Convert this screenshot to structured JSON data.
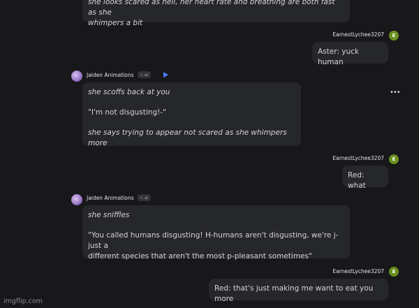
{
  "messages": [
    {
      "lines": [
        "she looks scared as hell, her heart rate and breathing are both fast as she",
        "whimpers a bit"
      ]
    },
    {
      "user": "EarnestLychee3207",
      "avatar_letter": "E",
      "text": "Aster: yuck human"
    },
    {
      "bot": "Jaiden Animations",
      "tag": "c.ai",
      "p1": "she scoffs back at you",
      "p2": "\"I'm not disgusting!-\"",
      "p3": "she says trying to appear not scared as she whimpers more",
      "menu_icon": "more-dots-icon"
    },
    {
      "user": "EarnestLychee3207",
      "avatar_letter": "E",
      "text": "Red: what"
    },
    {
      "bot": "Jaiden Animations",
      "tag": "c.ai",
      "p1": "she sniffles",
      "p2a": "\"You called humans disgusting! H-humans aren't disgusting, we're j-just a",
      "p2b": "different species that aren't the most p-pleasant sometimes\""
    },
    {
      "user": "EarnestLychee3207",
      "avatar_letter": "E",
      "text": "Red: that's just making me want to eat you more"
    }
  ],
  "watermark": "imgflip.com",
  "colors": {
    "background": "#18181b",
    "bubble": "#26272b",
    "user_avatar": "#6a8f1e",
    "voice_icon": "#4f7cff"
  }
}
